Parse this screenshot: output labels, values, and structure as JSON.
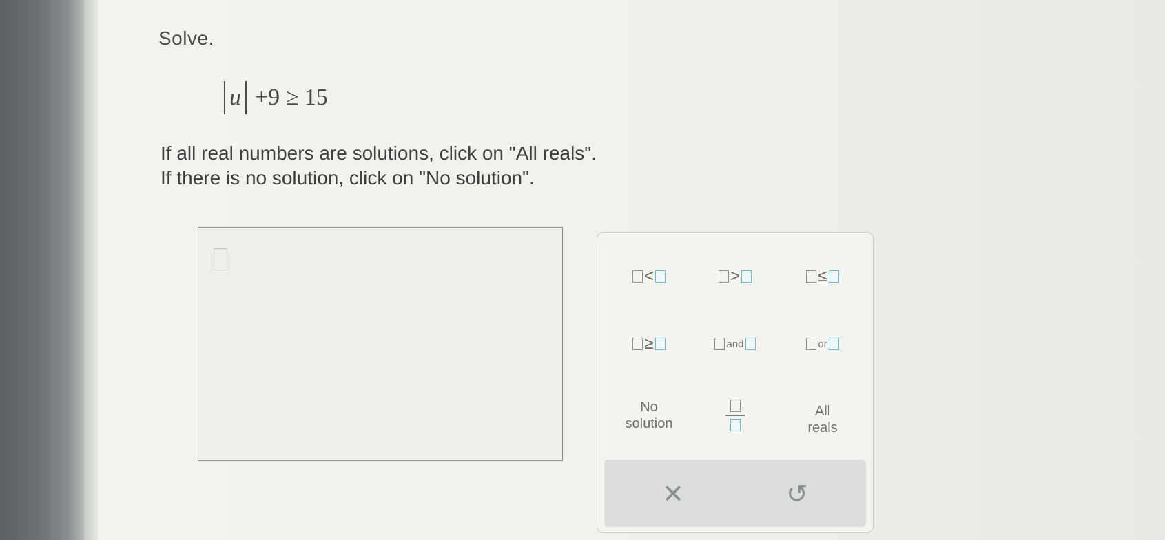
{
  "problem": {
    "heading": "Solve.",
    "equation": {
      "variable": "u",
      "rest": "+9 ≥ 15"
    },
    "instruction_all_reals": "If all real numbers are solutions, click on \"All reals\".",
    "instruction_no_solution": "If there is no solution, click on \"No solution\"."
  },
  "keypad": {
    "less_than": "<",
    "greater_than": ">",
    "less_equal": "≤",
    "greater_equal": "≥",
    "and": "and",
    "or": "or",
    "no_solution_line1": "No",
    "no_solution_line2": "solution",
    "all_reals_line1": "All",
    "all_reals_line2": "reals"
  },
  "actions": {
    "clear_symbol": "✕",
    "undo_symbol": "↺"
  },
  "colors": {
    "placeholder_blue": "#6fb6cf",
    "text": "#4a4a4a"
  }
}
